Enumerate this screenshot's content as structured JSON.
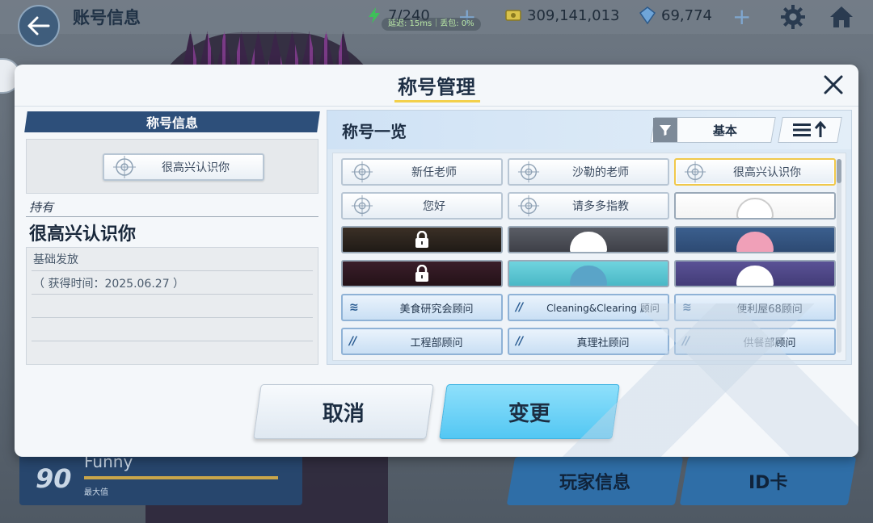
{
  "topbar": {
    "page_title": "账号信息",
    "ap": "7/240",
    "credits": "309,141,013",
    "gems": "69,774",
    "ping": "延迟: 15ms｜丢包: 0%"
  },
  "background": {
    "profile_name": "Funny",
    "level": "90",
    "level_caption": "最大值",
    "player_info_button": "玩家信息",
    "id_card_button": "ID卡"
  },
  "modal": {
    "title": "称号管理",
    "left": {
      "header": "称号信息",
      "current_title": "很高兴认识你",
      "owned_label": "持有",
      "owned_name": "很高兴认识你",
      "detail_source": "基础发放",
      "detail_time": "（ 获得时间：2025.06.27 ）"
    },
    "right": {
      "header": "称号一览",
      "filter_label": "基本",
      "titles": [
        {
          "kind": "plain",
          "label": "新任老师"
        },
        {
          "kind": "plain",
          "label": "沙勒的老师"
        },
        {
          "kind": "plain",
          "label": "很高兴认识你",
          "selected": true
        },
        {
          "kind": "plain",
          "label": "您好"
        },
        {
          "kind": "plain",
          "label": "请多多指教"
        },
        {
          "kind": "art",
          "label": ""
        },
        {
          "kind": "art",
          "label": ""
        },
        {
          "kind": "art",
          "label": ""
        },
        {
          "kind": "art",
          "label": ""
        },
        {
          "kind": "art",
          "label": ""
        },
        {
          "kind": "art",
          "label": ""
        },
        {
          "kind": "art",
          "label": ""
        },
        {
          "kind": "club",
          "label": "美食研究会顾问"
        },
        {
          "kind": "club",
          "label": "Cleaning&Clearing 顾问"
        },
        {
          "kind": "club",
          "label": "便利屋68顾问"
        },
        {
          "kind": "club",
          "label": "工程部顾问"
        },
        {
          "kind": "club",
          "label": "真理社顾问"
        },
        {
          "kind": "club",
          "label": "供餐部顾问"
        }
      ]
    },
    "cancel_button": "取消",
    "change_button": "变更"
  },
  "colors": {
    "accent_yellow": "#f3d04a",
    "change_button": "#53c7f3",
    "header_navy": "#2d4f7a"
  }
}
